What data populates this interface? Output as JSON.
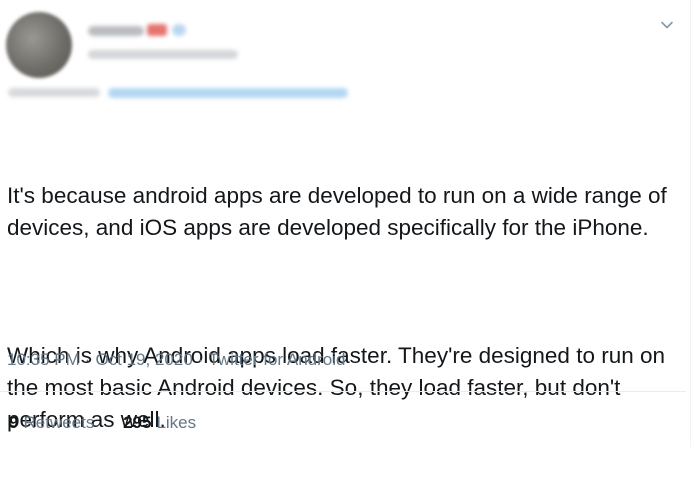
{
  "tweet": {
    "paragraphs": [
      "It's because android apps are developed to run on a wide range of devices, and iOS apps are developed specifically for the iPhone.",
      "Which is why Android apps load faster. They're designed to run on the most basic Android devices. So, they load faster, but don't perform as well."
    ],
    "time": "10:35 PM",
    "separator": "·",
    "date": "Oct 19, 2020",
    "source": "Twitter for Android",
    "retweets": {
      "count": "9",
      "label": "Retweets"
    },
    "likes": {
      "count": "295",
      "label": "Likes"
    }
  },
  "icons": {
    "more": "chevron-down-icon"
  },
  "colors": {
    "text": "#14171a",
    "muted": "#657786",
    "divider": "#e6ecf0"
  }
}
